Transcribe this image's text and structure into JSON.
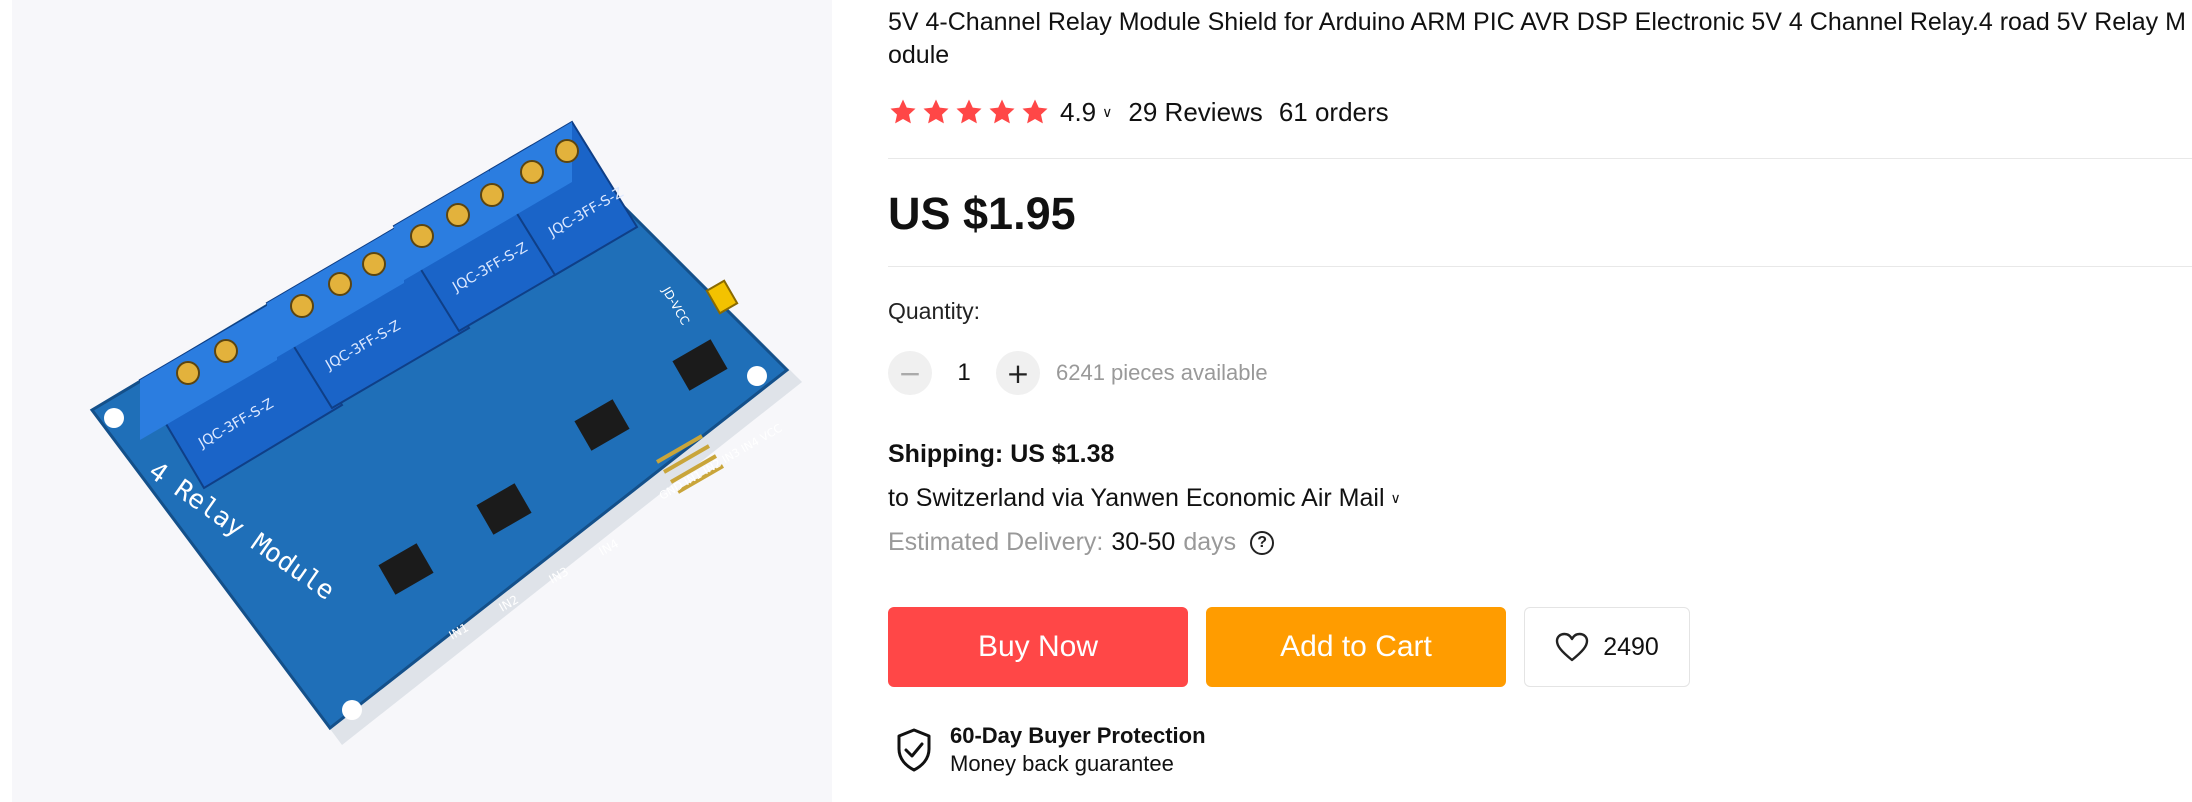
{
  "product": {
    "title": "5V 4-Channel Relay Module Shield for Arduino ARM PIC AVR DSP Electronic 5V 4 Channel Relay.4 road 5V Relay Module",
    "image": {
      "board_label": "4 Relay Module",
      "relay_text": "JQC-3FF-S-Z",
      "header_text": "GND IN1 IN2 IN3 IN4 VCC",
      "input_labels": [
        "IN1",
        "IN2",
        "IN3",
        "IN4"
      ],
      "jumper_label": "JD-VCC"
    }
  },
  "rating": {
    "stars": 5,
    "score": "4.9",
    "reviews": "29 Reviews",
    "orders": "61 orders",
    "star_color": "#ff4747"
  },
  "price": {
    "amount": "US $1.95"
  },
  "quantity": {
    "label": "Quantity:",
    "value": "1",
    "available": "6241 pieces available",
    "minus_icon": "minus-icon",
    "plus_icon": "plus-icon"
  },
  "shipping": {
    "cost": "Shipping: US $1.38",
    "route": "to Switzerland via Yanwen Economic Air Mail",
    "delivery_label": "Estimated Delivery:",
    "delivery_days": "30-50",
    "days_word": "days"
  },
  "actions": {
    "buy_now": "Buy Now",
    "add_to_cart": "Add to Cart",
    "wishlist_count": "2490",
    "buy_color": "#ff4747",
    "cart_color": "#ff9c00"
  },
  "protection": {
    "title": "60-Day Buyer Protection",
    "subtitle": "Money back guarantee"
  }
}
